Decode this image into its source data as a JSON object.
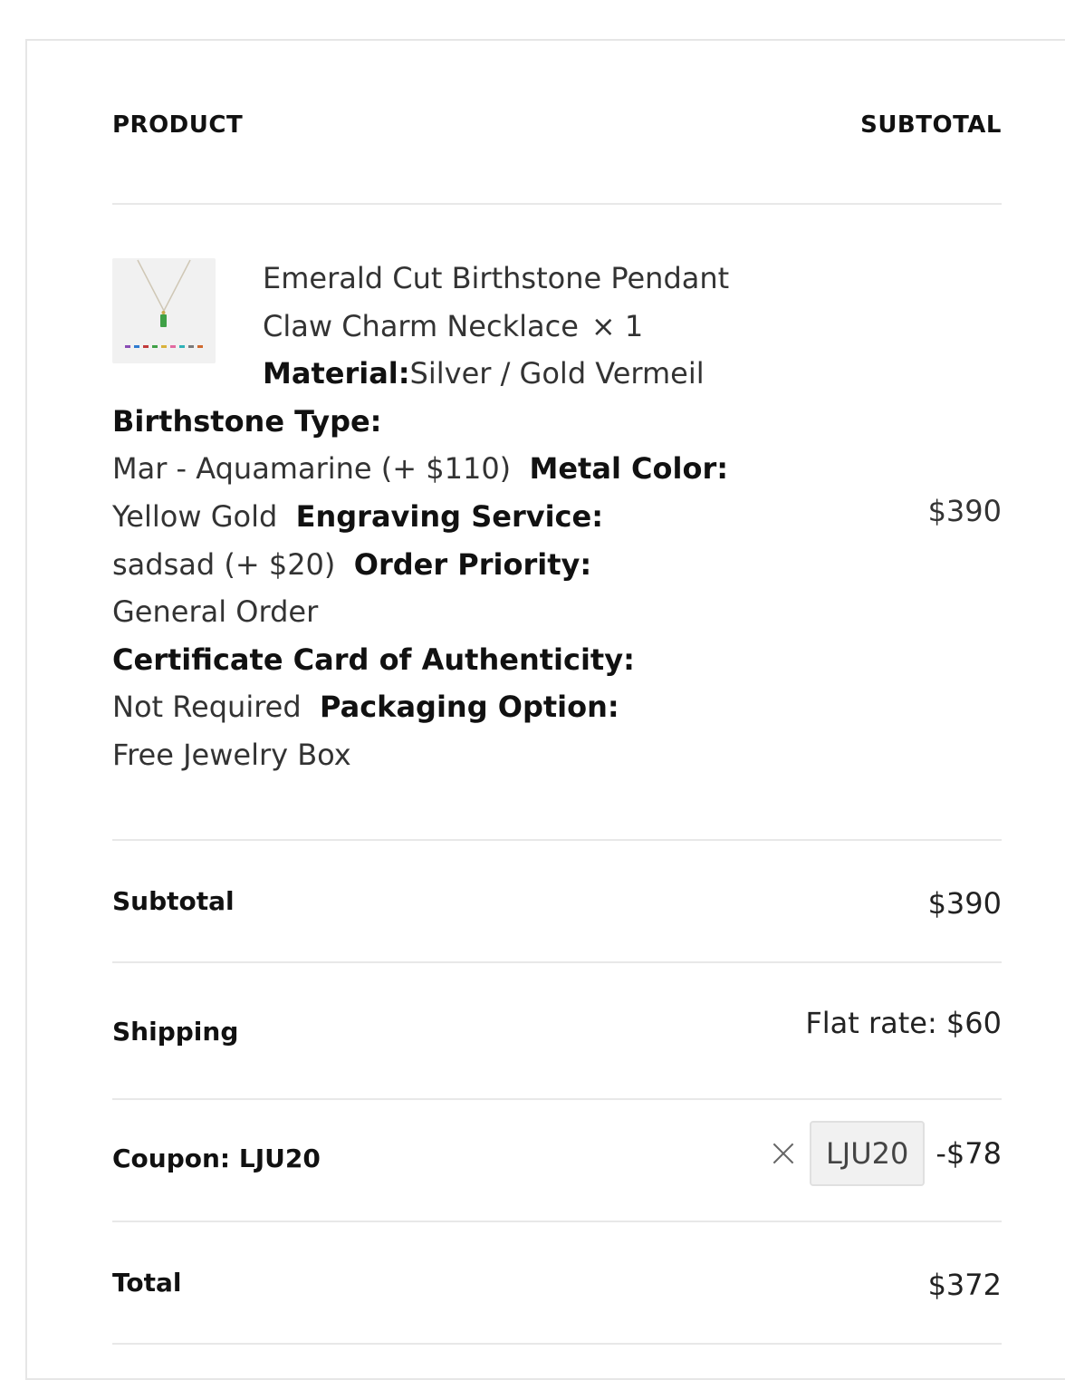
{
  "table": {
    "header_product": "PRODUCT",
    "header_subtotal": "SUBTOTAL"
  },
  "item": {
    "name": "Emerald Cut Birthstone Pendant Claw Charm Necklace",
    "qty": "× 1",
    "price": "$390",
    "meta": [
      {
        "label": "Material:",
        "value": "Silver / Gold Vermeil"
      },
      {
        "label": "Birthstone Type:",
        "value": "Mar - Aquamarine (+ $110)"
      },
      {
        "label": "Metal Color:",
        "value": "Yellow Gold"
      },
      {
        "label": "Engraving Service:",
        "value": "sadsad (+ $20)"
      },
      {
        "label": "Order Priority:",
        "value": "General Order"
      },
      {
        "label": "Certificate Card of Authenticity:",
        "value": "Not Required"
      },
      {
        "label": "Packaging Option:",
        "value": "Free Jewelry Box"
      }
    ]
  },
  "totals": {
    "subtotal_label": "Subtotal",
    "subtotal_value": "$390",
    "shipping_label": "Shipping",
    "shipping_value": "Flat rate: $60",
    "coupon_label": "Coupon: LJU20",
    "coupon_code": "LJU20",
    "coupon_amount": "-$78",
    "total_label": "Total",
    "total_value": "$372"
  },
  "icons": {
    "remove": "close-icon",
    "thumbnail": "necklace-thumbnail"
  }
}
